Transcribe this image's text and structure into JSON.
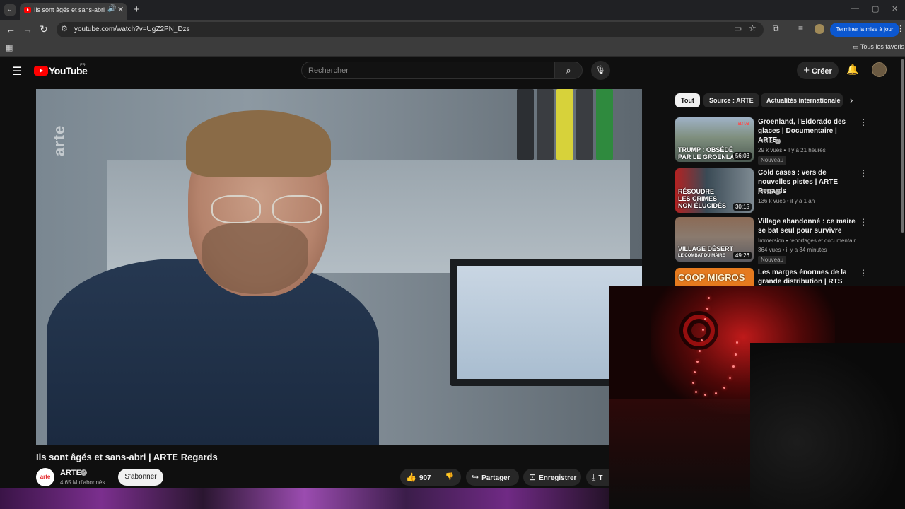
{
  "browser": {
    "tab_title": "Ils sont âgés et sans-abri | A",
    "url": "youtube.com/watch?v=UgZ2PN_Dzs",
    "update_button": "Terminer la mise à jour",
    "bookmarks_label": "Tous les favoris"
  },
  "header": {
    "logo_text": "YouTube",
    "country": "FR",
    "search_placeholder": "Rechercher",
    "create_label": "Créer"
  },
  "video": {
    "watermark": "arte",
    "title": "Ils sont âgés et sans-abri | ARTE Regards",
    "channel": "ARTE",
    "channel_avatar_text": "arte",
    "subscribers": "4,65 M d'abonnés",
    "subscribe_label": "S'abonner",
    "likes": "907",
    "share_label": "Partager",
    "save_label": "Enregistrer",
    "download_label": "T"
  },
  "chips": [
    "Tout",
    "Source : ARTE",
    "Actualités internationale"
  ],
  "related": [
    {
      "title": "Groenland, l'Eldorado des glaces | Documentaire | ARTE",
      "channel": "ARTE",
      "verified": true,
      "views": "29 k vues",
      "age": "il y a 21 heures",
      "badge": "Nouveau",
      "duration": "56:03",
      "thumb_caption_1": "TRUMP : OBSÉDÉ",
      "thumb_caption_2": "PAR LE GROENLAND",
      "thumb_tag": "arte"
    },
    {
      "title": "Cold cases : vers de nouvelles pistes | ARTE Regards",
      "channel": "ARTE",
      "verified": true,
      "views": "136 k vues",
      "age": "il y a 1 an",
      "badge": "",
      "duration": "30:15",
      "thumb_caption_1": "RÉSOUDRE",
      "thumb_caption_2": "LES CRIMES",
      "thumb_caption_3": "NON ÉLUCIDÉS"
    },
    {
      "title": "Village abandonné : ce maire se bat seul pour survivre",
      "channel": "Immersion",
      "channel_extra": "reportages et documentair...",
      "views": "364 vues",
      "age": "il y a 34 minutes",
      "badge": "Nouveau",
      "duration": "49:26",
      "thumb_caption_1": "VILLAGE DÉSERT",
      "thumb_caption_2": "LE COMBAT DU MAIRE"
    },
    {
      "title": "Les marges énormes de la grande distribution | RTS",
      "thumb_caption_1": "COOP MIGROS"
    }
  ],
  "colors": {
    "background": "#0f0f0f",
    "accent_red": "#ff0000",
    "update_blue": "#0b57d0"
  }
}
